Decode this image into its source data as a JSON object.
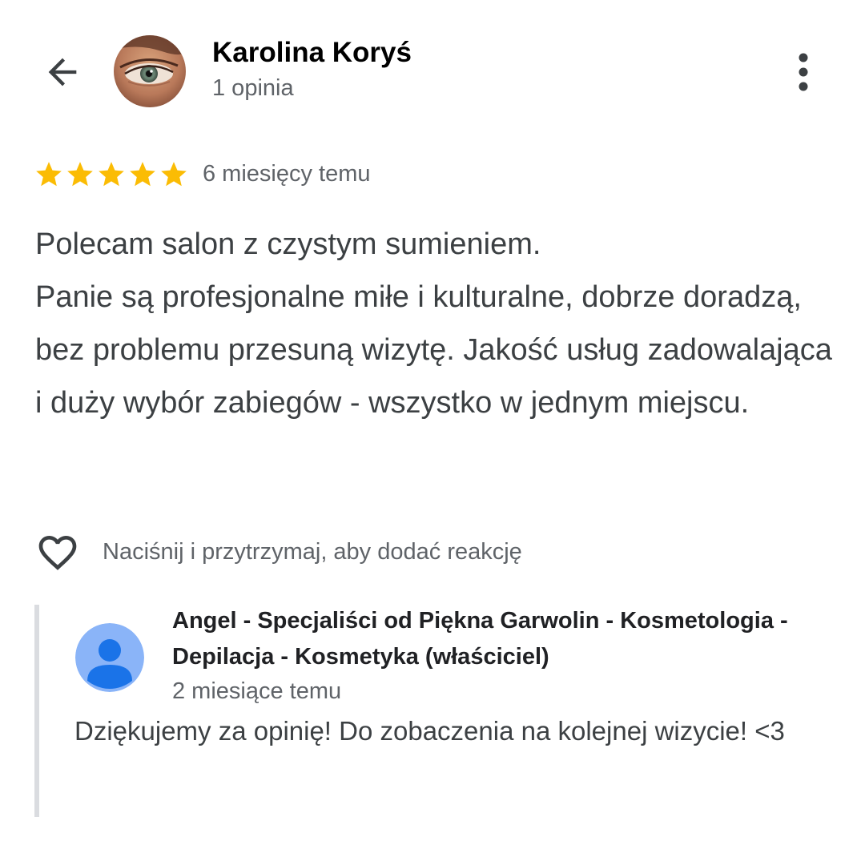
{
  "header": {
    "author_name": "Karolina Koryś",
    "author_review_count": "1 opinia",
    "back_icon": "arrow-back-icon",
    "more_icon": "more-vert-icon"
  },
  "review": {
    "rating": 5,
    "rating_max": 5,
    "star_color": "#fbbc04",
    "time": "6 miesięcy temu",
    "lines": [
      "Polecam salon z czystym sumieniem.",
      "Panie są profesjonalne miłe i kulturalne, dobrze doradzą, bez problemu przesuną wizytę. Jakość usług zadowalająca i duży wybór zabiegów - wszystko w jednym miejscu."
    ]
  },
  "reaction": {
    "icon": "heart-icon",
    "hint": "Naciśnij i przytrzymaj, aby dodać reakcję"
  },
  "owner_reply": {
    "name": "Angel - Specjaliści od Piękna Garwolin - Kosmetologia - Depilacja - Kosmetyka (właściciel)",
    "time": "2 miesiące temu",
    "text": "Dziękujemy za opinię! Do zobaczenia na kolejnej wizycie! <3",
    "avatar_color": "#8ab4f8",
    "avatar_figure_color": "#1a73e8"
  }
}
